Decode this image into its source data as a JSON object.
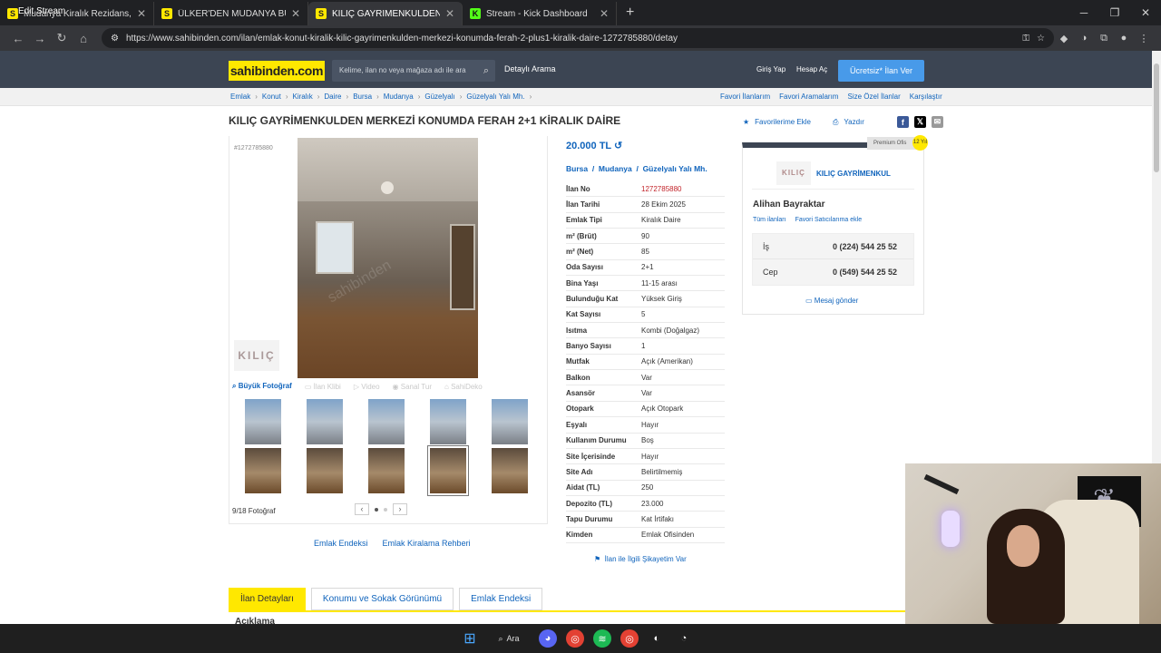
{
  "browser": {
    "tabs": [
      {
        "label": "Mudanya Kiralık Rezidans, Villa",
        "icon": "S",
        "color": "#ffe800",
        "active": false
      },
      {
        "label": "ÜLKER'DEN MUDANYA BURGAZ",
        "icon": "S",
        "color": "#ffe800",
        "active": false
      },
      {
        "label": "KILIÇ GAYRİMENKULDEN MERKEZİ",
        "icon": "S",
        "color": "#ffe800",
        "active": true
      },
      {
        "label": "Stream - Kick Dashboard",
        "icon": "K",
        "color": "#53fc18",
        "active": false
      }
    ],
    "url": "https://www.sahibinden.com/ilan/emlak-konut-kiralik-kilic-gayrimenkulden-merkezi-konumda-ferah-2-plus1-kiralik-daire-1272785880/detay",
    "overlay_text": "Edit Stream"
  },
  "header": {
    "logo": "sahibinden.com",
    "search_placeholder": "Kelime, ilan no veya mağaza adı ile ara",
    "detailed_search": "Detaylı Arama",
    "login": "Giriş Yap",
    "register": "Hesap Aç",
    "post_ad": "Ücretsiz* İlan Ver"
  },
  "breadcrumb": {
    "items": [
      "Emlak",
      "Konut",
      "Kiralık",
      "Daire",
      "Bursa",
      "Mudanya",
      "Güzelyalı",
      "Güzelyalı Yalı Mh."
    ],
    "right": [
      "Favori İlanlarım",
      "Favori Aramalarım",
      "Size Özel İlanlar",
      "Karşılaştır"
    ]
  },
  "listing": {
    "title": "KILIÇ GAYRİMENKULDEN MERKEZİ KONUMDA FERAH 2+1 KİRALIK DAİRE",
    "number_label": "#1272785880",
    "favorite": "Favorilerime Ekle",
    "print": "Yazdır",
    "price": "20.000 TL",
    "location": [
      "Bursa",
      "Mudanya",
      "Güzelyalı Yalı Mh."
    ],
    "details": [
      {
        "k": "İlan No",
        "v": "1272785880",
        "red": true
      },
      {
        "k": "İlan Tarihi",
        "v": "28 Ekim 2025"
      },
      {
        "k": "Emlak Tipi",
        "v": "Kiralık Daire"
      },
      {
        "k": "m² (Brüt)",
        "v": "90"
      },
      {
        "k": "m² (Net)",
        "v": "85"
      },
      {
        "k": "Oda Sayısı",
        "v": "2+1"
      },
      {
        "k": "Bina Yaşı",
        "v": "11-15 arası"
      },
      {
        "k": "Bulunduğu Kat",
        "v": "Yüksek Giriş"
      },
      {
        "k": "Kat Sayısı",
        "v": "5"
      },
      {
        "k": "Isıtma",
        "v": "Kombi (Doğalgaz)"
      },
      {
        "k": "Banyo Sayısı",
        "v": "1"
      },
      {
        "k": "Mutfak",
        "v": "Açık (Amerikan)"
      },
      {
        "k": "Balkon",
        "v": "Var"
      },
      {
        "k": "Asansör",
        "v": "Var"
      },
      {
        "k": "Otopark",
        "v": "Açık Otopark"
      },
      {
        "k": "Eşyalı",
        "v": "Hayır"
      },
      {
        "k": "Kullanım Durumu",
        "v": "Boş"
      },
      {
        "k": "Site İçerisinde",
        "v": "Hayır"
      },
      {
        "k": "Site Adı",
        "v": "Belirtilmemiş"
      },
      {
        "k": "Aidat (TL)",
        "v": "250"
      },
      {
        "k": "Depozito (TL)",
        "v": "23.000"
      },
      {
        "k": "Tapu Durumu",
        "v": "Kat İrtifakı"
      },
      {
        "k": "Kimden",
        "v": "Emlak Ofisinden"
      }
    ],
    "complaint": "İlan ile İlgili Şikayetim Var"
  },
  "gallery": {
    "tabs": [
      "Büyük Fotoğraf",
      "İlan Klibi",
      "Video",
      "Sanal Tur",
      "SahiDeko"
    ],
    "count": "9/18 Fotoğraf",
    "links": [
      "Emlak Endeksi",
      "Emlak Kiralama Rehberi"
    ],
    "watermark": "sahibinden",
    "agency_mark": "KILIÇ"
  },
  "seller": {
    "premium": "Premium Ofis",
    "badge": "12 Yıl",
    "logo": "KILIÇ",
    "company": "KILIÇ GAYRİMENKUL",
    "agent": "Alihan Bayraktar",
    "all_ads": "Tüm ilanları",
    "fav_seller": "Favori Satıcılarıma ekle",
    "phones": [
      {
        "k": "İş",
        "v": "0 (224) 544 25 52"
      },
      {
        "k": "Cep",
        "v": "0 (549) 544 25 52"
      }
    ],
    "message": "Mesaj gönder"
  },
  "bottom_tabs": [
    "İlan Detayları",
    "Konumu ve Sokak Görünümü",
    "Emlak Endeksi"
  ],
  "description_heading": "Açıklama",
  "taskbar": {
    "search": "Ara"
  }
}
